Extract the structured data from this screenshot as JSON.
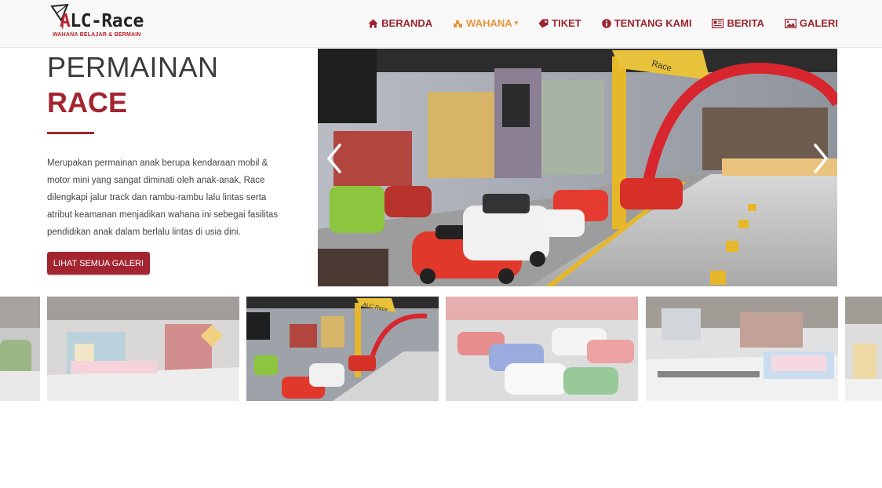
{
  "brand": {
    "name_accent": "A",
    "name_rest": "LC-Race",
    "tagline": "WAHANA BELAJAR & BERMAIN",
    "accent_color": "#a32530",
    "active_color": "#e8943a"
  },
  "nav": {
    "items": [
      {
        "label": "BERANDA",
        "icon": "home-icon"
      },
      {
        "label": "WAHANA",
        "icon": "ride-icon",
        "active": true,
        "dropdown": true
      },
      {
        "label": "TIKET",
        "icon": "ticket-icon"
      },
      {
        "label": "TENTANG KAMI",
        "icon": "info-icon"
      },
      {
        "label": "BERITA",
        "icon": "newspaper-icon"
      },
      {
        "label": "GALERI",
        "icon": "image-icon"
      }
    ]
  },
  "intro": {
    "heading_line1": "PERMAINAN",
    "heading_line2": "RACE",
    "description_lines": [
      "Merupakan permainan anak berupa kendaraan mobil &",
      "motor mini yang sangat diminati oleh anak-anak, Race",
      "dilengkapi jalur track dan rambu-rambu lalu lintas serta",
      "atribut keamanan menjadikan wahana ini sebegai fasilitas",
      "pendidikan anak dalam berlalu lintas di usia dini."
    ],
    "button_label": "LIHAT SEMUA GALERI"
  },
  "slider": {
    "sign_text": "Race",
    "prev_icon": "chevron-left-icon",
    "next_icon": "chevron-right-icon"
  },
  "gallery": {
    "active_index": 2,
    "gate_text": "ALC-Race"
  }
}
